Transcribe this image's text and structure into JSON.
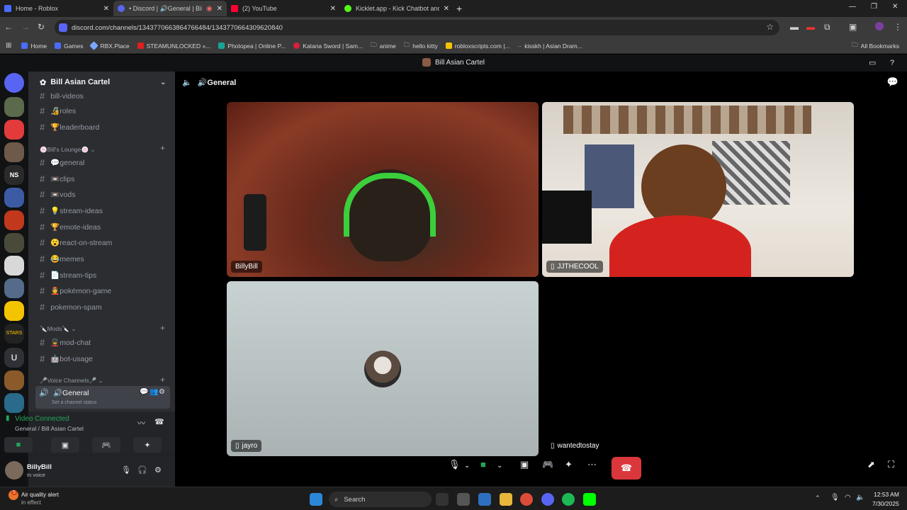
{
  "browser": {
    "tabs": [
      {
        "title": "Home - Roblox",
        "color": "#4a6cff"
      },
      {
        "title": "• Discord | 🔊General | Bill",
        "color": "#5865f2"
      },
      {
        "title": "(2) YouTube",
        "color": "#ff0033"
      },
      {
        "title": "Kicklet.app - Kick Chatbot and",
        "color": "#53fc18"
      }
    ],
    "url": "discord.com/channels/1343770663864766484/1343770664309620840",
    "bookmarks": [
      {
        "label": "Home",
        "color": "#4a6cff"
      },
      {
        "label": "Games",
        "color": "#4a6cff"
      },
      {
        "label": "RBX.Place",
        "color": "#7aa7ff"
      },
      {
        "label": "STEAMUNLOCKED »...",
        "color": "#e02020"
      },
      {
        "label": "Photopea | Online P...",
        "color": "#18a497"
      },
      {
        "label": "Katana Sword | Sam...",
        "color": "#d61f3a"
      },
      {
        "label": "anime",
        "color": "#888888"
      },
      {
        "label": "hello kitty",
        "color": "#888888"
      },
      {
        "label": "robloxscripts.com |...",
        "color": "#f5c400"
      },
      {
        "label": "kisskh | Asian Dram...",
        "color": "#aaaaaa"
      }
    ],
    "all_bookmarks": "All Bookmarks"
  },
  "discord": {
    "window_title": "Bill Asian Cartel",
    "server_name": "Bill Asian Cartel",
    "channels_top": [
      {
        "label": "bill-videos"
      },
      {
        "label": "🔏roles"
      },
      {
        "label": "🏆leaderboard"
      }
    ],
    "cat_lounge": "🍥Bill's Lounge🍥",
    "channels_lounge": [
      {
        "label": "💬general"
      },
      {
        "label": "📼clips"
      },
      {
        "label": "📼vods"
      },
      {
        "label": "💡stream-ideas"
      },
      {
        "label": "🏆emote-ideas"
      },
      {
        "label": "😮react-on-stream"
      },
      {
        "label": "😂memes"
      },
      {
        "label": "📄stream-tips"
      },
      {
        "label": "👲pokémon-game"
      },
      {
        "label": "pokemon-spam"
      }
    ],
    "cat_mods": "🔪Mods🔪",
    "channels_mods": [
      {
        "label": "💂mod-chat"
      },
      {
        "label": "🤖bot-usage"
      }
    ],
    "cat_voice": "🎤Voice Channels🎤",
    "voice_channel": "🔊General",
    "voice_status": "Set a channel status",
    "connection": {
      "title": "Video Connected",
      "subtitle": "General / Bill Asian Cartel"
    },
    "user": {
      "name": "BillyBill",
      "status": "In voice"
    },
    "stage_title": "🔊General",
    "participants": [
      {
        "name": "BillyBill",
        "has_phone_icon": false
      },
      {
        "name": "JJTHECOOL",
        "has_phone_icon": true
      },
      {
        "name": "jayro",
        "has_phone_icon": true
      },
      {
        "name": "wantedtostay",
        "has_phone_icon": true
      }
    ]
  },
  "taskbar": {
    "weather_title": "Air quality alert",
    "weather_sub": "in effect",
    "weather_badge": "5",
    "search": "Search",
    "time": "12:53 AM",
    "date": "7/30/2025"
  }
}
